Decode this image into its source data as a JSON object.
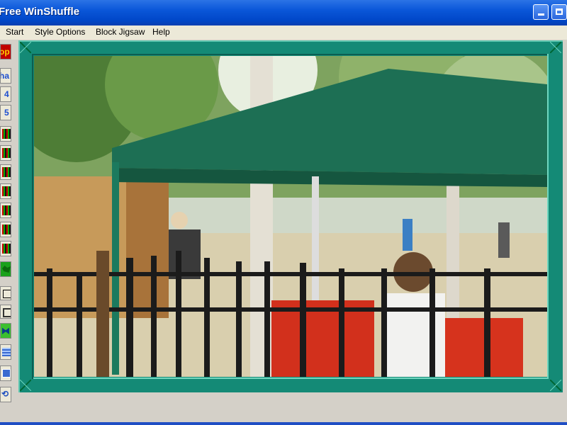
{
  "window": {
    "title": "Free WinShuffle"
  },
  "menu": {
    "items": [
      "Start",
      "Style Options",
      "Block Jigsaw",
      "Help"
    ]
  },
  "toolbar": {
    "labels": {
      "top": "op",
      "alpha": "ha",
      "n4": "4",
      "n5": "5"
    }
  },
  "colors": {
    "frame": "#148a76",
    "titlebar": "#0a56d8"
  }
}
